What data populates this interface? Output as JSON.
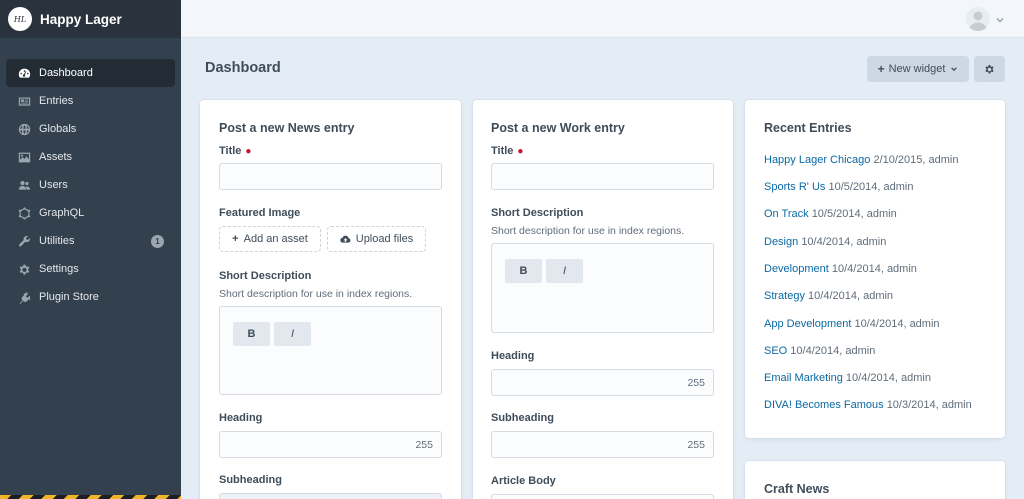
{
  "app": {
    "site_name": "Happy Lager",
    "logo_text": "HL"
  },
  "sidebar": {
    "items": [
      {
        "label": "Dashboard",
        "icon": "gauge-icon",
        "active": true
      },
      {
        "label": "Entries",
        "icon": "newspaper-icon"
      },
      {
        "label": "Globals",
        "icon": "globe-icon"
      },
      {
        "label": "Assets",
        "icon": "image-icon"
      },
      {
        "label": "Users",
        "icon": "users-icon"
      },
      {
        "label": "GraphQL",
        "icon": "graphql-icon"
      },
      {
        "label": "Utilities",
        "icon": "wrench-icon",
        "badge": "1"
      },
      {
        "label": "Settings",
        "icon": "gear-icon"
      },
      {
        "label": "Plugin Store",
        "icon": "plug-icon"
      }
    ]
  },
  "header": {
    "title": "Dashboard",
    "new_widget_label": "New widget"
  },
  "news_widget": {
    "title": "Post a new News entry",
    "title_label": "Title",
    "featured_image_label": "Featured Image",
    "add_asset_label": "Add an asset",
    "upload_files_label": "Upload files",
    "short_desc_label": "Short Description",
    "short_desc_instructions": "Short description for use in index regions.",
    "bold_label": "B",
    "italic_label": "I",
    "heading_label": "Heading",
    "heading_count": "255",
    "subheading_label": "Subheading"
  },
  "work_widget": {
    "title": "Post a new Work entry",
    "title_label": "Title",
    "short_desc_label": "Short Description",
    "short_desc_instructions": "Short description for use in index regions.",
    "bold_label": "B",
    "italic_label": "I",
    "heading_label": "Heading",
    "heading_count": "255",
    "subheading_label": "Subheading",
    "subheading_count": "255",
    "article_body_label": "Article Body"
  },
  "recent_entries": {
    "title": "Recent Entries",
    "entries": [
      {
        "title": "Happy Lager Chicago",
        "meta": "2/10/2015, admin"
      },
      {
        "title": "Sports R' Us",
        "meta": "10/5/2014, admin"
      },
      {
        "title": "On Track",
        "meta": "10/5/2014, admin"
      },
      {
        "title": "Design",
        "meta": "10/4/2014, admin"
      },
      {
        "title": "Development",
        "meta": "10/4/2014, admin"
      },
      {
        "title": "Strategy",
        "meta": "10/4/2014, admin"
      },
      {
        "title": "App Development",
        "meta": "10/4/2014, admin"
      },
      {
        "title": "SEO",
        "meta": "10/4/2014, admin"
      },
      {
        "title": "Email Marketing",
        "meta": "10/4/2014, admin"
      },
      {
        "title": "DIVA! Becomes Famous",
        "meta": "10/3/2014, admin"
      }
    ]
  },
  "craft_news": {
    "title": "Craft News"
  },
  "colors": {
    "sidebar_bg": "#33404d",
    "sidebar_header_bg": "#29323d",
    "page_bg": "#e4edf6",
    "link": "#0b69a3",
    "required": "#cf1124"
  }
}
